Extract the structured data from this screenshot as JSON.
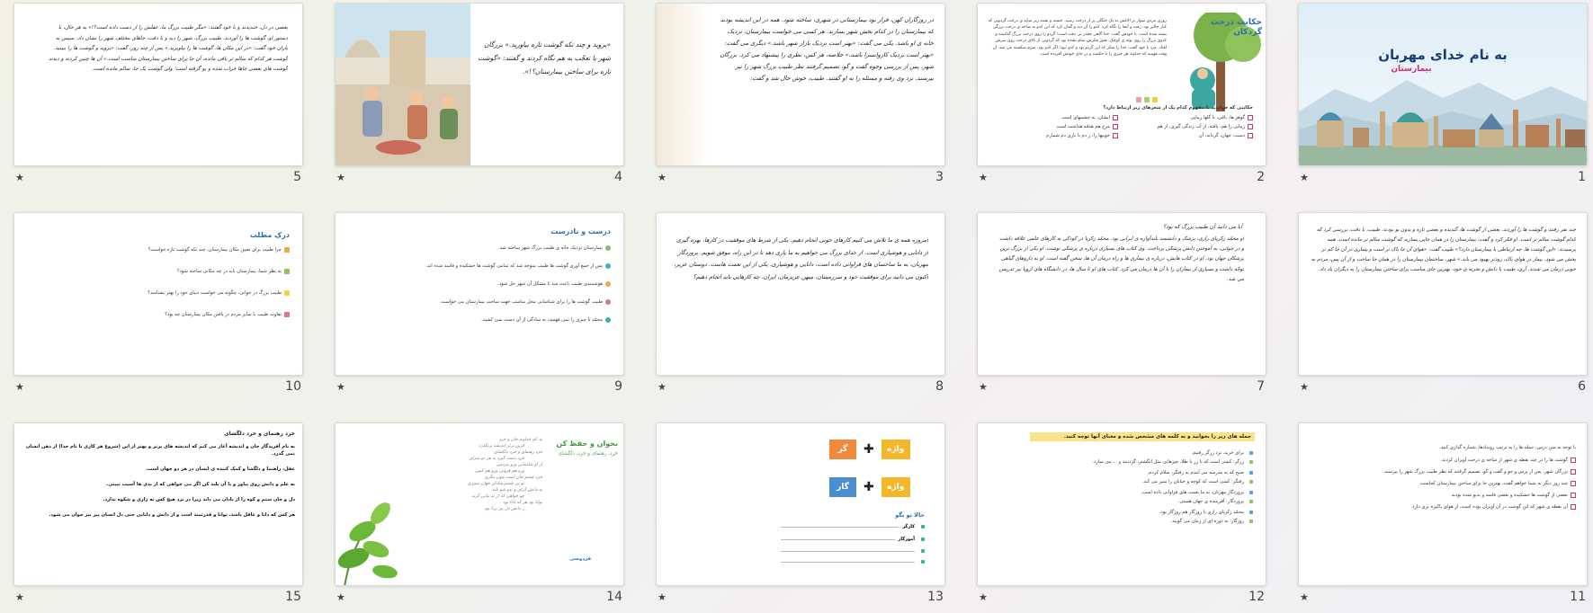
{
  "slides": [
    {
      "num": "1",
      "title": "به نام خدای مهربان",
      "subtitle": "بیمارستان"
    },
    {
      "num": "2",
      "title": "حکایت درخت گردکان",
      "body": "روزی مردی سوار بر الاغش به یک جنگلی پر از درخت رسید. خسته و تشنه زیر سایه ی درخت گردویی که کنار جالیز بود، رفت و آنجا را نگاه کرد. کدو را آن دید و گمان کرد که این کدو به شاخه ی درخت بزرگی بسته شده است. با خودش گفت: خدا گاهی چقدر بی دقت است؛ گردو را روی درخت بزرگ گذاشته و کدوی بزرگ را روی بوته ی کوچک. هنوز فکرش تمام نشده بود که گردویی از بالای درخت روی سرش افتاد. مرد با خود گفت: خدا را شکر که این گردو بود و کدو نبود؛ اگر کدو بود، سرم شکسته می شد. آن وقت فهمید که خداوند هر چیزی را با حکمت و در جای خودش آفریده است.",
      "question": "حکایتی که خواندید با مفهوم کدام یک از شعرهای زیر ارتباط دارد؟",
      "options": [
        "گوهر ها، باقی، با گلها زیبایی",
        "زیبایی را هم، یافته، از آب زندگی گیری، از هم",
        "دست، جهان، گرداند، آن",
        "ایشان، نه چشمهای است",
        "مرغ هم هدفه هداشت است",
        "خوبیها را، ز دم با بازی دم شمارم"
      ]
    },
    {
      "num": "3",
      "body": "در روزگاران کهن، قرار بود بیمارستانی در شهری، ساخته شود. همه در این اندیشه بودند که بیمارستان را در کدام بخش شهر بسازند. هر کسی می خواست بیمارستان، نزدیک خانه ی او باشد. یکی می گفت: «بهتر است نزدیک بازار شهر باشد.» دیگری می گفت: «بهتر است نزدیک کاروانسرا باشد.» خلاصه، هر کس، نظری را پیشنهاد می کرد. بزرگان شهر، پس از بررسی وجوه گفت و گو، تصمیم گرفتند نظر طبیب بزرگ شهر را نیز بپرسند. نزد وی رفته و مسئله را به او گفتند. طبیب، خوش حال شد و گفت:"
    },
    {
      "num": "4",
      "body": "«بروید و چند تکه گوشت تازه بیاورید.» بزرگان شهر با تعجّب به هم نگاه کردند و گفتند: «گوشت تازه برای ساختن بیمارستان؟!»."
    },
    {
      "num": "5",
      "body": "بعضی در دل، خندیدند و با خود گفتند: «مگر طبیب بزرگ ما، عقلش را از دست داده است؟!» به هر حال، با دستور او، گوشت ها را آوردند. طبیب بزرگ، شهر را دید و با دقت، جاهای مختلف شهر را نشان داد. سپس به یاران خود گفت: «در این مکان ها، گوشت ها را بیاویزید.» پس از چند روز، گفت: «بروید و گوشت ها را ببینید. گوشت هر کدام که سالم تر باقی مانده، آن جا برای ساختن بیمارستان مناسب است.» آن ها چنین کردند و دیدند گوشت های بعضی جاها خراب شده و بو گرفته است؛ ولی گوشت یک جا، سالم مانده است."
    },
    {
      "num": "6",
      "body": "چند نفر رفتند و گوشت ها را آوردند. بعضی از گوشت ها، گندیده و بعضی تازه و بدون بو بودند. طبیب، با دقت، بررسی کرد که کدام گوشت سالم تر است. او فکر کرد و گفت: بیمارستان را در همان جایی بسازید که گوشت سالم تر مانده است. همه پرسیدند: «این گوشت ها، چه ارتباطی با بیمارستان دارد؟» طبیب گفت: «هوای آن جا پاک تر است و بیماری در آن جا کم تر پخش می شود. بیمار در هوای پاک، زودتر بهبود می یابد.» شهر، ساختمان بیمارستان را در همان جا ساخت و از آن پس، مردم به خوبی درمان می شدند. آری، طبیب با دانش و تجربه ی خود، بهترین جای مناسب برای ساختن بیمارستان را به دیگران یاد داد."
    },
    {
      "num": "7",
      "title": "آیا می دانید آن طبیب بزرگ که بود؟",
      "body": "او محمّد زکریای رازی، پزشک و دانشمند بلندآوازه ی ایرانی بود. محمّد زکریا در کودکی به کارهای علمی علاقه داشت و در جوانی، به آموختن دانش پزشکی پرداخت. وی کتاب های بسیاری درباره ی پزشکی نوشت. او یکی از بزرگ ترین پزشکان جهان بود. او در کتاب هایش، درباره ی بیماری ها و راه درمان آن ها، سخن گفته است. او به داروهای گیاهی توجّه داشت و بسیاری از بیماران را با آن ها درمان می کرد. کتاب های او تا سال ها، در دانشگاه های اروپا نیز تدریس می شد."
    },
    {
      "num": "8",
      "body": "امروزه همه ی ما تلاش می کنیم کارهای خوبی انجام دهیم. یکی از شرط های موفقیت در کارها، بهره گیری از دانایی و هوشیاری است. از خدای بزرگ می خواهیم به ما یاری دهد تا در این راه، موفق شویم. پروردگار مهربان، به ما ساختمان های فراوانی داده است. دانایی و هوشیاری، یکی از این نعمت هاست. دوستان عزیز، اکنون می دانید برای موفقیت خود و سرزمینتان، میهن عزیزمان، ایران، چه کارهایی باید انجام دهیم؟"
    },
    {
      "num": "9",
      "title": "درست و نادرست",
      "items": [
        "بیمارستان نزدیک خانه ی طبیب بزرگ شهر ساخته شد.",
        "پس از جمع آوری گوشت ها طبیب متوجه شد که تمامی گوشت ها خشکیده و فاسد شده اند.",
        "هوشمندی طبیب باعث شد تا مشکل آن شهر حل شود.",
        "طبیب گوشت ها را برای شناسایی محل مناسب جهت ساخت بیمارستان می خواست.",
        "محمّد تا چیزی را نمی فهمید، به سادگی از آن دست نمی کشید."
      ]
    },
    {
      "num": "10",
      "title": "درک مطلب",
      "items": [
        "چرا طبیب برای تعیین مکان بیمارستان، چند تکه گوشت تازه خواست؟",
        "به نظر شما، بیمارستان باید در چه مکانی ساخته شود؟",
        "طبیب بزرگ در جوانی، چگونه می خواست دنیای خود را بهتر بشناسد؟",
        "تفاوت طبیب با سایر مردم در یافتن مکان بیمارستان چه بود؟"
      ]
    },
    {
      "num": "11",
      "title": "با توجه به متن درس، جمله ها را به ترتیب رویدادها، شماره گذاری کنید.",
      "items": [
        "گوشت ها را در چند نقطه ی شهر از شاخه ی درخت آویزان کردند.",
        "بزرگان شهر، پس از پرس و جو و گفت و گو، تصمیم گرفتند که نظر طبیب بزرگ شهر را بپرسند.",
        "چند روز دیگر به شما خواهم گفت، بهترین جا برای ساختن بیمارستان کجاست.",
        "بعضی از گوشت ها خشکیده و بعضی فاسد و بدبو شده بودند.",
        "آن نقطه ی شهر که این گوشت در آن آویزان بوده است، از هوای پاکیزه تری دارد."
      ]
    },
    {
      "num": "12",
      "title": "جمله های زیر را بخوانید و به کلمه های مشخص شده و معنای آنها توجه کنید.",
      "items": [
        "برای خرید، نزد زرگر رفتیم.",
        "زرگر: کسی است که با زر یا طلا، چیزهایی مثل انگشتر، گردنبند و ... می سازد.",
        "صبح که به مدرسه می آمدم به رفتگر، سلام کردم.",
        "رفتگر: کسی است که کوچه و خیابان را تمیز می کند.",
        "پروردگار مهربان، به ما نعمت های فراوانی داده است.",
        "پروردگار: آفریننده ی جهان هستی.",
        "محمّد زکریای رازی با روزگار هم روزگار بود.",
        "روزگار: به دوره ای از زمان می گویند."
      ]
    },
    {
      "num": "13",
      "word1": "واژه",
      "suffix1": "گر",
      "word2": "واژه",
      "suffix2": "گار",
      "label": "حالا تو بگو",
      "examples": [
        "کارگر",
        "آموزگار"
      ]
    },
    {
      "num": "14",
      "title": "بخوان و حفظ کن",
      "subtitle": "خرد، رهنمای و خرد، دلگشای",
      "author": "فردوسی",
      "poem": [
        "به نام خداوند جان و خرد",
        "کزین برتر اندیشه برنگذرد",
        "خرد رهنمای و خرد دلگشای",
        "خرد دست گیرد به هر دو سرای",
        "از او شادمانی وزو مردمی",
        "وزو هم فزونی وزو هم کمی",
        "خرد چشم جان است چون بنگری",
        "تو بی چشم شادان جهان نسپری",
        "به دانش گرای و بدو شو بلند",
        "چو خواهی که از بد نیابی گزند",
        "توانا بود هر که دانا بود",
        "ز دانش دل پیر برنا بود"
      ]
    },
    {
      "num": "15",
      "title": "خرد رهنمای و خرد دلگشای",
      "lines": [
        "به نام آفریدگار جان و اندیشه آغاز می کنم که اندیشه های برتر و بهتر از این (شروع هر کاری با نام خدا) از ذهن انسان نمی گذرد.",
        "عقل، راهنما و دلگشا و کمک کننده ی انسان در هر دو جهان است.",
        "به علم و دانش روی بیاور و با آن بلند کن اگر می خواهی که از بدی ها آسیب نبینی.",
        "دل و جان ستم و کوه را از نادان می داند زیرا در نزد هیچ کس نه زاری و شکوه ندارد.",
        "هر کس که دانا و عاقل باشد، توانا و قدرتمند است و از دانش و دانایی حتی دل انسان پیر نیز جوان می شود."
      ]
    }
  ]
}
